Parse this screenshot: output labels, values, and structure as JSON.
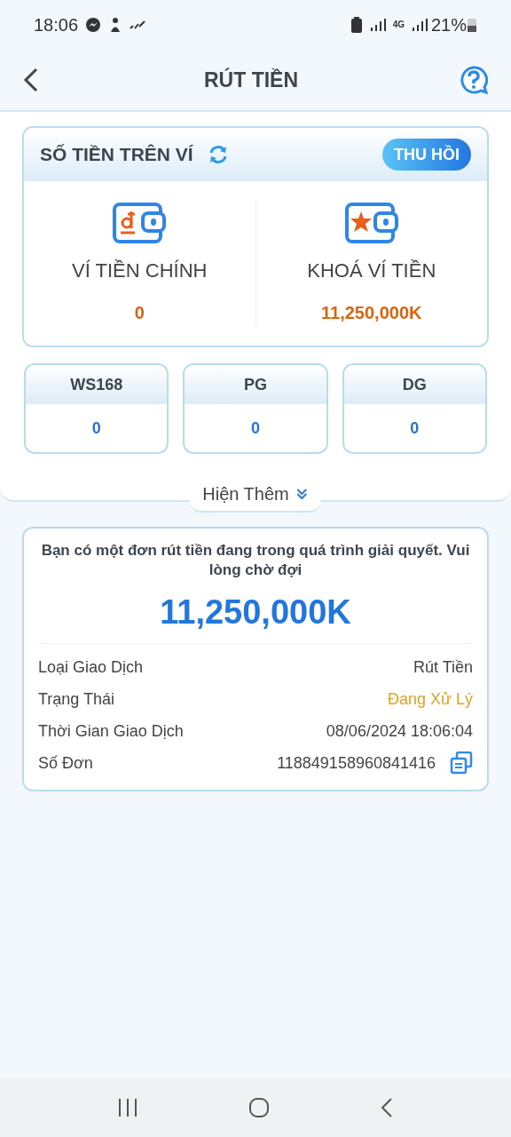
{
  "status_bar": {
    "time": "18:06",
    "network": "4G",
    "battery": "21%"
  },
  "header": {
    "title": "RÚT TIỀN"
  },
  "wallet": {
    "title": "SỐ TIỀN TRÊN VÍ",
    "recall_button": "THU HỒI",
    "items": [
      {
        "kind": "main",
        "label": "VÍ TIỀN CHÍNH",
        "amount": "0"
      },
      {
        "kind": "locked",
        "label": "KHOÁ VÍ TIỀN",
        "amount": "11,250,000K"
      }
    ]
  },
  "games": [
    {
      "name": "WS168",
      "amount": "0"
    },
    {
      "name": "PG",
      "amount": "0"
    },
    {
      "name": "DG",
      "amount": "0"
    }
  ],
  "show_more": "Hiện Thêm",
  "pending": {
    "message": "Bạn có một đơn rút tiền đang trong quá trình giải quyết. Vui lòng chờ đợi",
    "amount": "11,250,000K",
    "rows": [
      {
        "kind": "plain",
        "label": "Loại Giao Dịch",
        "value": "Rút Tiền"
      },
      {
        "kind": "status",
        "label": "Trạng Thái",
        "value": "Đang Xử Lý"
      },
      {
        "kind": "plain",
        "label": "Thời Gian Giao Dịch",
        "value": "08/06/2024 18:06:04"
      },
      {
        "kind": "copy",
        "label": "Số Đơn",
        "value": "118849158960841416"
      }
    ]
  }
}
